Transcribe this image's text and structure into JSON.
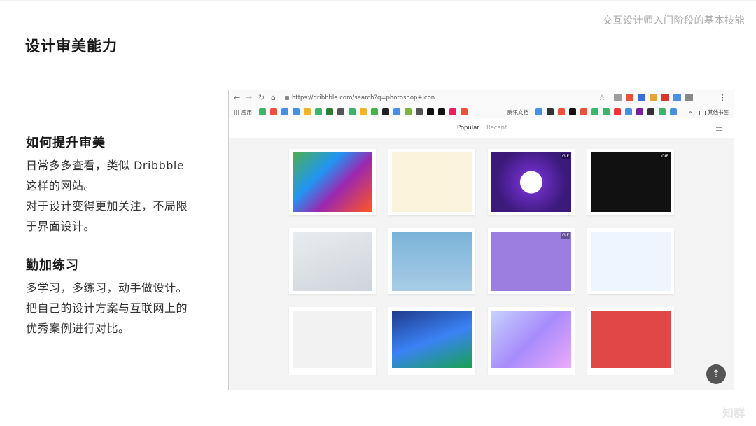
{
  "slide": {
    "corner_title": "交互设计师入门阶段的基本技能",
    "title": "设计审美能力",
    "watermark": "知群"
  },
  "left": {
    "section1": {
      "heading": "如何提升审美",
      "lines": [
        "日常多多查看，类似 Dribbble",
        "这样的网站。",
        "对于设计变得更加关注，不局限",
        "于界面设计。"
      ]
    },
    "section2": {
      "heading": "勤加练习",
      "lines": [
        "多学习，多练习，动手做设计。",
        "把自己的设计方案与互联网上的",
        "优秀案例进行对比。"
      ]
    }
  },
  "browser": {
    "url": "https://dribbble.com/search?q=photoshop+icon",
    "bookmarks": {
      "apps_label": "应用",
      "tencent_docs": "腾讯文档",
      "more": "»",
      "other_bookmarks": "其他书签"
    },
    "tabs": {
      "popular": "Popular",
      "recent": "Recent"
    },
    "ext_colors": [
      "#9e9e9e",
      "#e8543a",
      "#3b6fd8",
      "#e8a23a",
      "#d8372c",
      "#4a90e2",
      "#888888"
    ],
    "bookmark_colors": [
      "#3db36b",
      "#e8543a",
      "#4a90e2",
      "#4a90e2",
      "#f0b429",
      "#3db36b",
      "#2e7d32",
      "#555555",
      "#3db36b",
      "#f0b429",
      "#4caf50",
      "#222222",
      "#4a90e2",
      "#7cb342",
      "#555555",
      "#111111",
      "#111111",
      "#e91e63",
      "#e8543a"
    ],
    "bookmark_colors2": [
      "#4a90e2",
      "#333333",
      "#e8543a",
      "#111111",
      "#e8543a",
      "#3db36b",
      "#3db36b",
      "#e53935",
      "#4a90e2",
      "#7b1fa2",
      "#333333",
      "#3db36b",
      "#4a90e2"
    ],
    "shots": [
      {
        "name": "shot-icons-city",
        "bg": "linear-gradient(135deg,#4caf50 0%,#2196f3 35%,#9c27b0 60%,#ff5722 100%)",
        "badge": ""
      },
      {
        "name": "shot-onboarding",
        "bg": "#fbf3dc",
        "badge": ""
      },
      {
        "name": "shot-comet-app",
        "bg": "radial-gradient(circle at 50% 50%,#ffffff 0 22%,#6a2cc0 23%,#3b1a7a 70%)",
        "badge": "GIF"
      },
      {
        "name": "shot-dark-phone",
        "bg": "#111111",
        "badge": "GIF"
      },
      {
        "name": "shot-contacts-list",
        "bg": "linear-gradient(160deg,#e9ecef,#cfd4da)",
        "badge": ""
      },
      {
        "name": "shot-health-poster",
        "bg": "linear-gradient(180deg,#7ab3d9,#a8cce6)",
        "badge": ""
      },
      {
        "name": "shot-purple-virus",
        "bg": "#9b7ee0",
        "badge": "GIF"
      },
      {
        "name": "shot-travel-app",
        "bg": "#eef5ff",
        "badge": ""
      },
      {
        "name": "shot-isometric",
        "bg": "#f2f2f2",
        "badge": ""
      },
      {
        "name": "shot-30000-illustration",
        "bg": "linear-gradient(160deg,#1e3a8a,#3b82f6 50%,#16a34a)",
        "badge": ""
      },
      {
        "name": "shot-gradient-phones",
        "bg": "linear-gradient(135deg,#c7d2fe,#a78bfa,#f0abfc)",
        "badge": ""
      },
      {
        "name": "shot-bearded-logo",
        "bg": "#e04848",
        "badge": ""
      }
    ]
  }
}
